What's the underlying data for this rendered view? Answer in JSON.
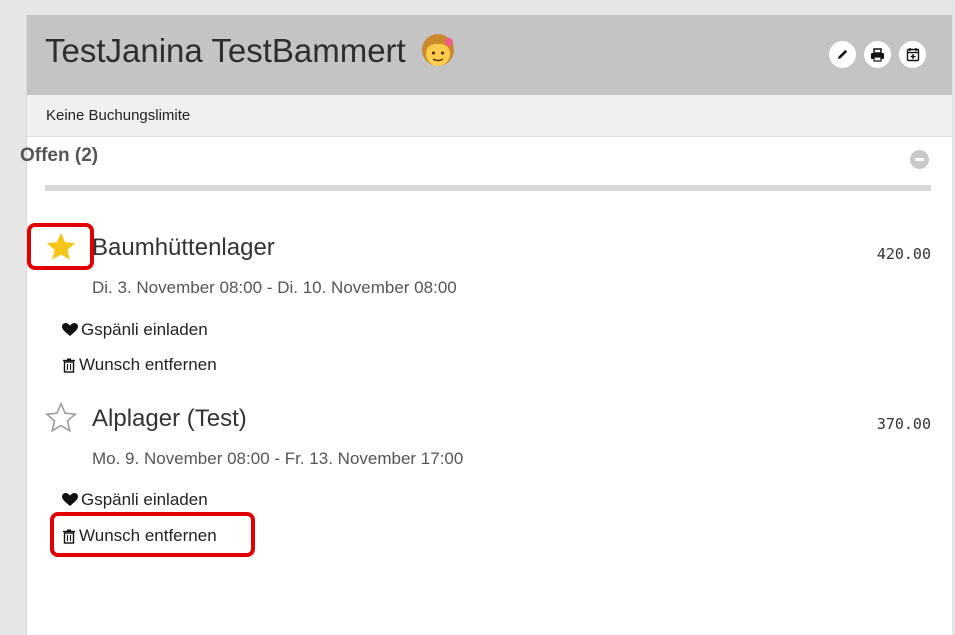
{
  "header": {
    "title": "TestJanina TestBammert",
    "avatar_icon": "girl-emoji-icon",
    "actions": [
      {
        "icon": "pencil-icon"
      },
      {
        "icon": "printer-icon"
      },
      {
        "icon": "calendar-plus-icon"
      }
    ]
  },
  "limit": {
    "text": "Keine Buchungslimite"
  },
  "section": {
    "title": "Offen (2)",
    "collapse_icon": "minus-circle-icon"
  },
  "items": [
    {
      "title": "Baumhüttenlager",
      "price": "420.00",
      "dates": "Di. 3. November 08:00 - Di. 10. November 08:00",
      "favorite": true,
      "invite_label": "Gspänli einladen",
      "remove_label": "Wunsch entfernen"
    },
    {
      "title": "Alplager (Test)",
      "price": "370.00",
      "dates": "Mo. 9. November 08:00 - Fr. 13. November 17:00",
      "favorite": false,
      "invite_label": "Gspänli einladen",
      "remove_label": "Wunsch entfernen"
    }
  ],
  "colors": {
    "header_bg": "#c4c4c4",
    "star_filled": "#f5c518",
    "highlight": "#e00000"
  }
}
